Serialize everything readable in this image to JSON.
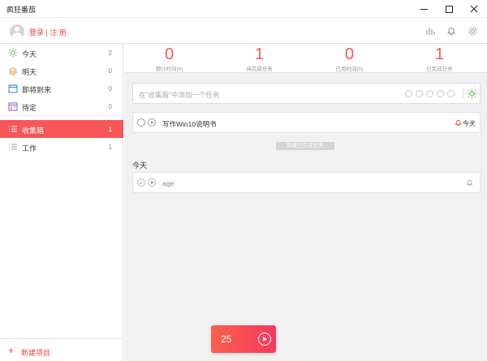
{
  "window": {
    "title": "疯狂番茄",
    "controls": {
      "minimize": "minimize-icon",
      "maximize": "maximize-icon",
      "close": "close-icon"
    }
  },
  "header": {
    "login_label": "登录 | 注 册",
    "icons": [
      "stats-icon",
      "bell-icon",
      "gear-icon"
    ]
  },
  "sidebar": {
    "items": [
      {
        "label": "今天",
        "count": "2",
        "icon": "sun-icon",
        "color": "#6ab04c"
      },
      {
        "label": "明天",
        "count": "0",
        "icon": "sunset-icon",
        "color": "#f0932b"
      },
      {
        "label": "即将到来",
        "count": "0",
        "icon": "calendar-icon",
        "color": "#2e86de"
      },
      {
        "label": "待定",
        "count": "0",
        "icon": "calendar-pending-icon",
        "color": "#9b59b6"
      }
    ],
    "projects": [
      {
        "label": "收集箱",
        "count": "1",
        "icon": "list-icon",
        "active": true
      },
      {
        "label": "工作",
        "count": "1",
        "icon": "list-icon",
        "active": false
      }
    ],
    "new_project_label": "新建项目"
  },
  "stats": [
    {
      "value": "0",
      "caption": "预计时间(h)"
    },
    {
      "value": "1",
      "caption": "待完成任务"
    },
    {
      "value": "0",
      "caption": "已用时间(h)"
    },
    {
      "value": "1",
      "caption": "已完成任务"
    }
  ],
  "add_task": {
    "placeholder": "在\"收集箱\"中添加一个任务",
    "tomato_count_icons": 5
  },
  "tasks": [
    {
      "name": "写作Win10说明书",
      "due": "今天",
      "completed": false
    }
  ],
  "hide_completed_label": "隐藏已完成任务",
  "completed_section": {
    "title": "今天",
    "tasks": [
      {
        "name": "age",
        "completed": true
      }
    ]
  },
  "timer": {
    "minutes": "25"
  },
  "colors": {
    "accent": "#f65656",
    "number": "#f25a4f",
    "today_green": "#6ab04c"
  }
}
